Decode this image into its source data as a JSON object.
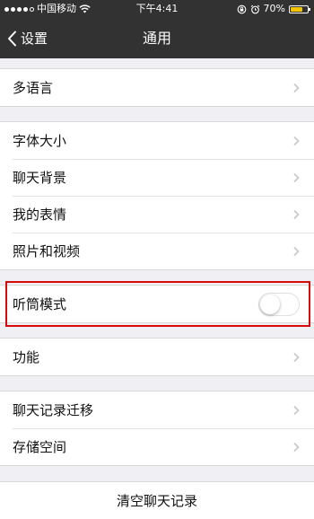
{
  "status_bar": {
    "carrier": "中国移动",
    "time": "下午4:41",
    "battery_pct": "70%",
    "battery_level": 0.7,
    "icons": [
      "signal-icon",
      "wifi-icon",
      "lock-rotation-icon",
      "alarm-icon",
      "battery-icon"
    ]
  },
  "nav": {
    "back_label": "设置",
    "title": "通用"
  },
  "groups": {
    "language": {
      "items": [
        {
          "label": "多语言"
        }
      ]
    },
    "display": {
      "items": [
        {
          "label": "字体大小"
        },
        {
          "label": "聊天背景"
        },
        {
          "label": "我的表情"
        },
        {
          "label": "照片和视频"
        }
      ]
    },
    "earpiece": {
      "label": "听筒模式",
      "toggle_on": false
    },
    "features": {
      "items": [
        {
          "label": "功能"
        }
      ]
    },
    "storage": {
      "items": [
        {
          "label": "聊天记录迁移"
        },
        {
          "label": "存储空间"
        }
      ]
    },
    "clear": {
      "label": "清空聊天记录"
    }
  },
  "colors": {
    "nav_bg": "#323232",
    "page_bg": "#efeff4",
    "highlight": "#d60a0a",
    "battery": "#f5c400"
  }
}
